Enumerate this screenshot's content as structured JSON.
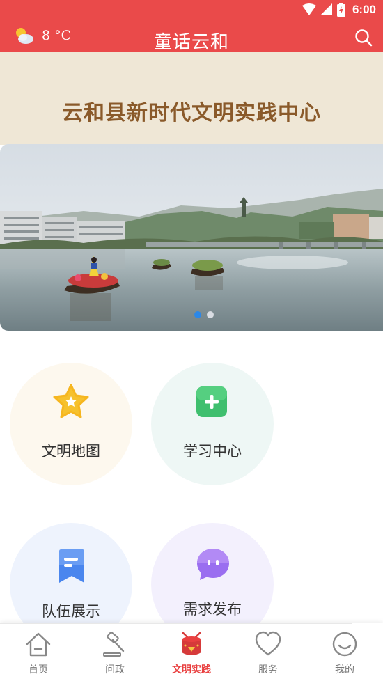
{
  "status_bar": {
    "time": "6:00"
  },
  "header": {
    "temperature": "8 °C",
    "title": "童话云和",
    "weather_icon": "partly-cloudy-icon",
    "search_icon": "search-icon"
  },
  "banner": {
    "title": "云和县新时代文明实践中心",
    "slide_count": 2,
    "active_slide": 1
  },
  "features": [
    {
      "label": "文明地图",
      "icon": "star-icon",
      "bg": "#fdf8ee",
      "accent": "#f6c12d"
    },
    {
      "label": "学习中心",
      "icon": "plus-square-icon",
      "bg": "#eef7f5",
      "accent": "#3fbf6e"
    },
    {
      "label": "队伍展示",
      "icon": "bookmark-icon",
      "bg": "#eef3fd",
      "accent": "#4a86ee"
    },
    {
      "label": "需求发布",
      "icon": "chat-bubble-icon",
      "bg": "#f3f0fd",
      "accent": "#9a6ef0"
    }
  ],
  "tabs": [
    {
      "label": "首页",
      "icon": "home-icon",
      "active": false
    },
    {
      "label": "问政",
      "icon": "gavel-icon",
      "active": false
    },
    {
      "label": "文明实践",
      "icon": "drum-icon",
      "active": true
    },
    {
      "label": "服务",
      "icon": "heart-icon",
      "active": false
    },
    {
      "label": "我的",
      "icon": "smiley-icon",
      "active": false
    }
  ],
  "colors": {
    "brand": "#ea4a4a",
    "banner_bg": "#efe7d6",
    "title_brown": "#8a5a2a",
    "active_tab": "#e94040",
    "dot_active": "#2c88e8"
  }
}
